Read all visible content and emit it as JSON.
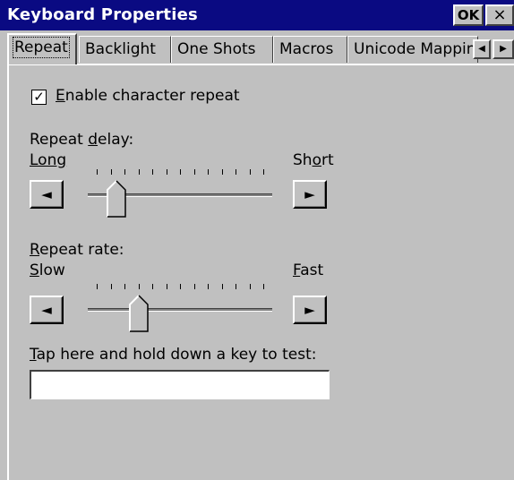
{
  "window": {
    "title": "Keyboard Properties",
    "ok_label": "OK",
    "close_label": "×"
  },
  "tabs": [
    {
      "label": "Repeat",
      "active": true
    },
    {
      "label": "Backlight",
      "active": false
    },
    {
      "label": "One Shots",
      "active": false
    },
    {
      "label": "Macros",
      "active": false
    },
    {
      "label": "Unicode Mappin",
      "active": false
    }
  ],
  "tab_scroll": {
    "left_icon": "◀",
    "right_icon": "▶"
  },
  "enable_repeat": {
    "checked": true,
    "check_mark": "✓",
    "label_mnemonic": "E",
    "label_rest": "nable character repeat"
  },
  "repeat_delay": {
    "heading_pre": "Repeat ",
    "heading_mnemonic": "d",
    "heading_post": "elay:",
    "left_label": "Long",
    "right_label_pre": "Sh",
    "right_label_mnemonic": "o",
    "right_label_post": "rt",
    "position": 0.12,
    "tick_count": 13,
    "dec_icon": "◄",
    "inc_icon": "►"
  },
  "repeat_rate": {
    "heading_mnemonic": "R",
    "heading_post": "epeat rate:",
    "left_label_mnemonic": "S",
    "left_label_post": "low",
    "right_label_mnemonic": "F",
    "right_label_post": "ast",
    "position": 0.25,
    "tick_count": 13,
    "dec_icon": "◄",
    "inc_icon": "►"
  },
  "test_field": {
    "label_mnemonic": "T",
    "label_rest": "ap here and hold down a key to test:",
    "value": ""
  }
}
